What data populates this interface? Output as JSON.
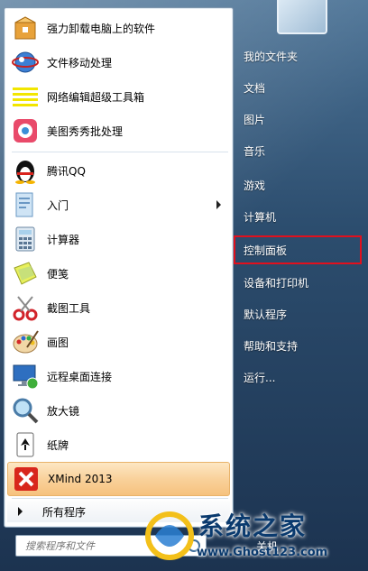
{
  "left_items": [
    {
      "label": "强力卸载电脑上的软件",
      "icon": "uninstaller-box-icon"
    },
    {
      "label": "文件移动处理",
      "icon": "file-mover-icon"
    },
    {
      "label": "网络编辑超级工具箱",
      "icon": "network-editor-icon"
    },
    {
      "label": "美图秀秀批处理",
      "icon": "meitu-batch-icon"
    },
    {
      "label": "腾讯QQ",
      "icon": "qq-penguin-icon"
    },
    {
      "label": "入门",
      "icon": "getting-started-icon",
      "has_submenu": true
    },
    {
      "label": "计算器",
      "icon": "calculator-icon"
    },
    {
      "label": "便笺",
      "icon": "sticky-notes-icon"
    },
    {
      "label": "截图工具",
      "icon": "snipping-tool-icon"
    },
    {
      "label": "画图",
      "icon": "paint-palette-icon"
    },
    {
      "label": "远程桌面连接",
      "icon": "remote-desktop-icon"
    },
    {
      "label": "放大镜",
      "icon": "magnifier-icon"
    },
    {
      "label": "纸牌",
      "icon": "solitaire-card-icon"
    },
    {
      "label": "XMind 2013",
      "icon": "xmind-icon",
      "highlighted": true
    }
  ],
  "all_programs": "所有程序",
  "search": {
    "placeholder": "搜索程序和文件"
  },
  "right_items": [
    {
      "label": "我的文件夹"
    },
    {
      "label": "文档"
    },
    {
      "label": "图片"
    },
    {
      "label": "音乐"
    },
    {
      "label": "游戏"
    },
    {
      "label": "计算机"
    },
    {
      "label": "控制面板",
      "active": true
    },
    {
      "label": "设备和打印机"
    },
    {
      "label": "默认程序"
    },
    {
      "label": "帮助和支持"
    },
    {
      "label": "运行..."
    }
  ],
  "shutdown_partial": "关机",
  "watermark": {
    "brand": "系统之家",
    "site": "www.Ghost123.com"
  },
  "colors": {
    "highlight_red": "#e2101d",
    "hover_orange": "#f6c27e"
  }
}
